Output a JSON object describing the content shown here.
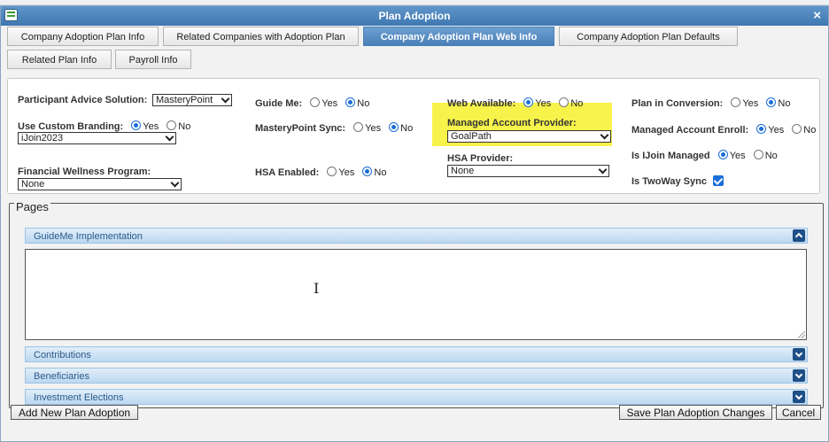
{
  "window": {
    "title": "Plan Adoption",
    "close": "×"
  },
  "tabs": [
    {
      "label": "Company Adoption Plan Info"
    },
    {
      "label": "Related Companies with Adoption Plan"
    },
    {
      "label": "Company Adoption Plan Web Info",
      "active": true
    },
    {
      "label": "Company Adoption Plan Defaults"
    },
    {
      "label": "Related Plan Info"
    },
    {
      "label": "Payroll Info"
    }
  ],
  "radio_labels": {
    "yes": "Yes",
    "no": "No"
  },
  "fields": {
    "participant_advice": {
      "label": "Participant Advice Solution:",
      "value": "MasteryPoint"
    },
    "custom_branding": {
      "label": "Use Custom Branding:",
      "selected": "Yes",
      "value": "iJoin2023"
    },
    "financial_wellness": {
      "label": "Financial Wellness Program:",
      "value": "None"
    },
    "guide_me": {
      "label": "Guide Me:",
      "selected": "No"
    },
    "masterypoint_sync": {
      "label": "MasteryPoint Sync:",
      "selected": "No"
    },
    "hsa_enabled": {
      "label": "HSA Enabled:",
      "selected": "No"
    },
    "web_available": {
      "label": "Web Available:",
      "selected": "Yes"
    },
    "managed_account_provider": {
      "label": "Managed Account Provider:",
      "value": "GoalPath"
    },
    "hsa_provider": {
      "label": "HSA Provider:",
      "value": "None"
    },
    "plan_in_conversion": {
      "label": "Plan in Conversion:",
      "selected": "No"
    },
    "managed_account_enroll": {
      "label": "Managed Account Enroll:",
      "selected": "Yes"
    },
    "is_ijoin_managed": {
      "label": "Is IJoin Managed",
      "selected": "Yes"
    },
    "is_twoway_sync": {
      "label": "Is TwoWay Sync",
      "checked": true
    }
  },
  "pages": {
    "legend": "Pages",
    "sections": [
      {
        "label": "GuideMe Implementation",
        "expanded": true
      },
      {
        "label": "Contributions",
        "expanded": false
      },
      {
        "label": "Beneficiaries",
        "expanded": false
      },
      {
        "label": "Investment Elections",
        "expanded": false
      }
    ]
  },
  "buttons": {
    "add_new": "Add New Plan Adoption",
    "save": "Save Plan Adoption Changes",
    "cancel": "Cancel"
  },
  "colors": {
    "titlebar": "#4a80b8",
    "active_tab": "#5b8ec4",
    "highlight": "#f7f34a",
    "accordion": "#cfe3f5"
  }
}
